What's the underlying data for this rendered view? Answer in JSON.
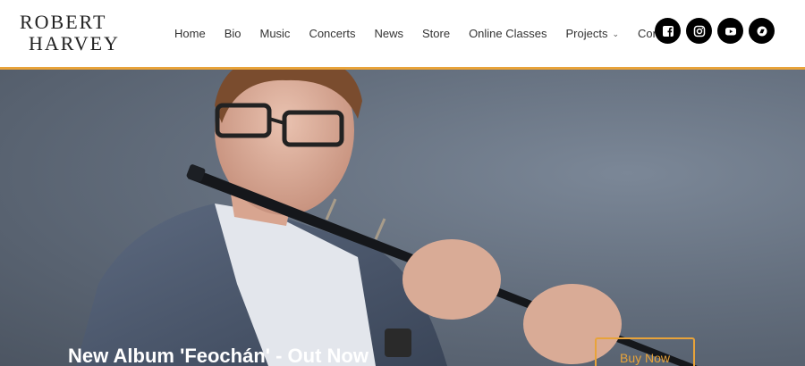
{
  "logo": {
    "line1": "ROBERT",
    "line2": "HARVEY"
  },
  "nav": {
    "items": [
      {
        "label": "Home"
      },
      {
        "label": "Bio"
      },
      {
        "label": "Music"
      },
      {
        "label": "Concerts"
      },
      {
        "label": "News"
      },
      {
        "label": "Store"
      },
      {
        "label": "Online Classes"
      },
      {
        "label": "Projects",
        "has_dropdown": true
      },
      {
        "label": "Contact"
      }
    ]
  },
  "social": [
    {
      "icon": "facebook-icon"
    },
    {
      "icon": "instagram-icon"
    },
    {
      "icon": "youtube-icon"
    },
    {
      "icon": "bandcamp-icon"
    }
  ],
  "hero": {
    "title": "New Album 'Feochán' - Out Now",
    "button_label": "Buy Now"
  },
  "colors": {
    "accent": "#e8a33a",
    "header_bg": "#ffffff",
    "hero_bg": "#646f7e",
    "text": "#333333"
  }
}
